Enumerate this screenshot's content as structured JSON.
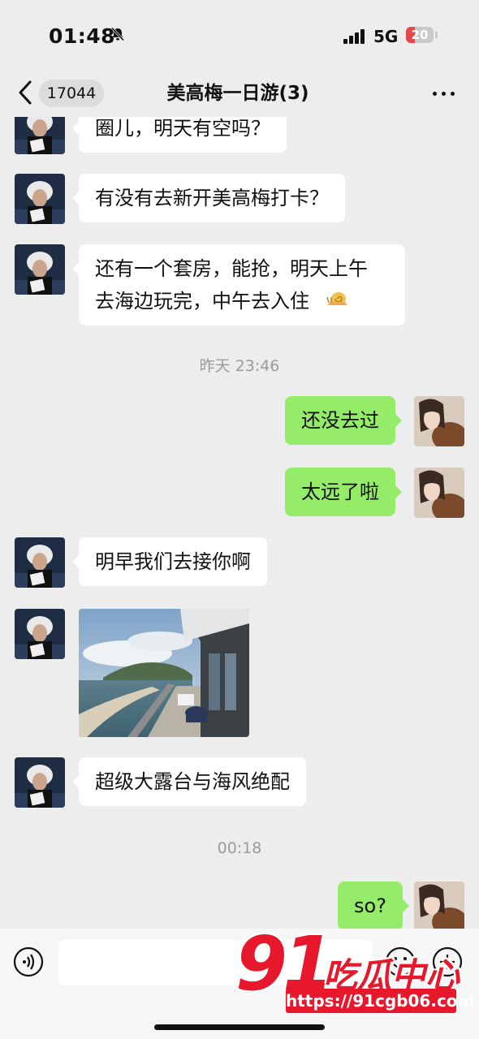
{
  "status_bar": {
    "time": "01:48",
    "network": "5G",
    "battery": "20"
  },
  "nav": {
    "unread_count": "17044",
    "title": "美高梅一日游(3)"
  },
  "messages": [
    {
      "side": "in",
      "text": "圈儿，明天有空吗？"
    },
    {
      "side": "in",
      "text": "有没有去新开美高梅打卡？"
    },
    {
      "side": "in",
      "text": "还有一个套房，能抢，明天上午\n去海边玩完，中午去入住"
    },
    {
      "type": "time",
      "text": "昨天 23:46"
    },
    {
      "side": "out",
      "text": "还没去过"
    },
    {
      "side": "out",
      "text": "太远了啦"
    },
    {
      "side": "in",
      "text": "明早我们去接你啊"
    },
    {
      "side": "in",
      "type": "image"
    },
    {
      "side": "in",
      "text": "超级大露台与海风绝配"
    },
    {
      "type": "time",
      "text": "00:18"
    },
    {
      "side": "out",
      "text": "so?"
    }
  ],
  "watermark": {
    "number": "91",
    "name": "吃瓜中心",
    "url": "https://91cgb06.com"
  },
  "colors": {
    "background": "#ededed",
    "bubble_out": "#95ec69",
    "bubble_in": "#ffffff",
    "watermark": "#e8182c"
  }
}
